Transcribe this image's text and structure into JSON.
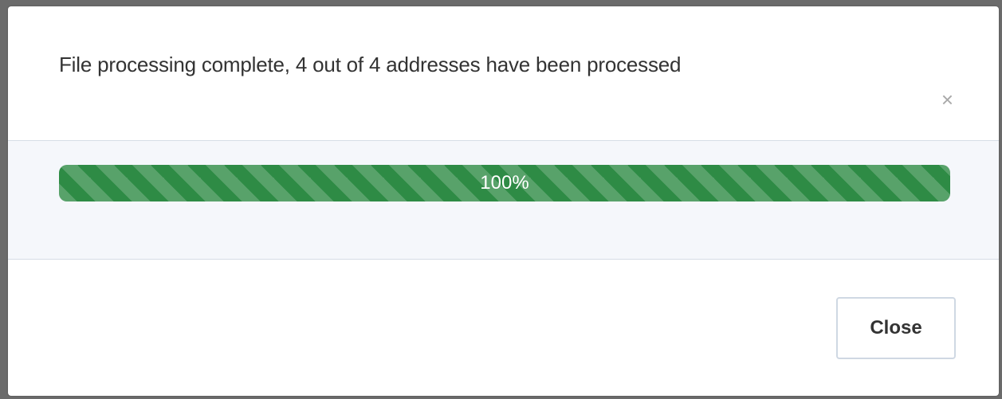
{
  "dialog": {
    "message": "File processing complete, 4 out of 4 addresses have been processed",
    "dismiss_icon": "×",
    "progress": {
      "percent": 100,
      "label": "100%",
      "color": "#2e8b45"
    },
    "close_label": "Close"
  }
}
